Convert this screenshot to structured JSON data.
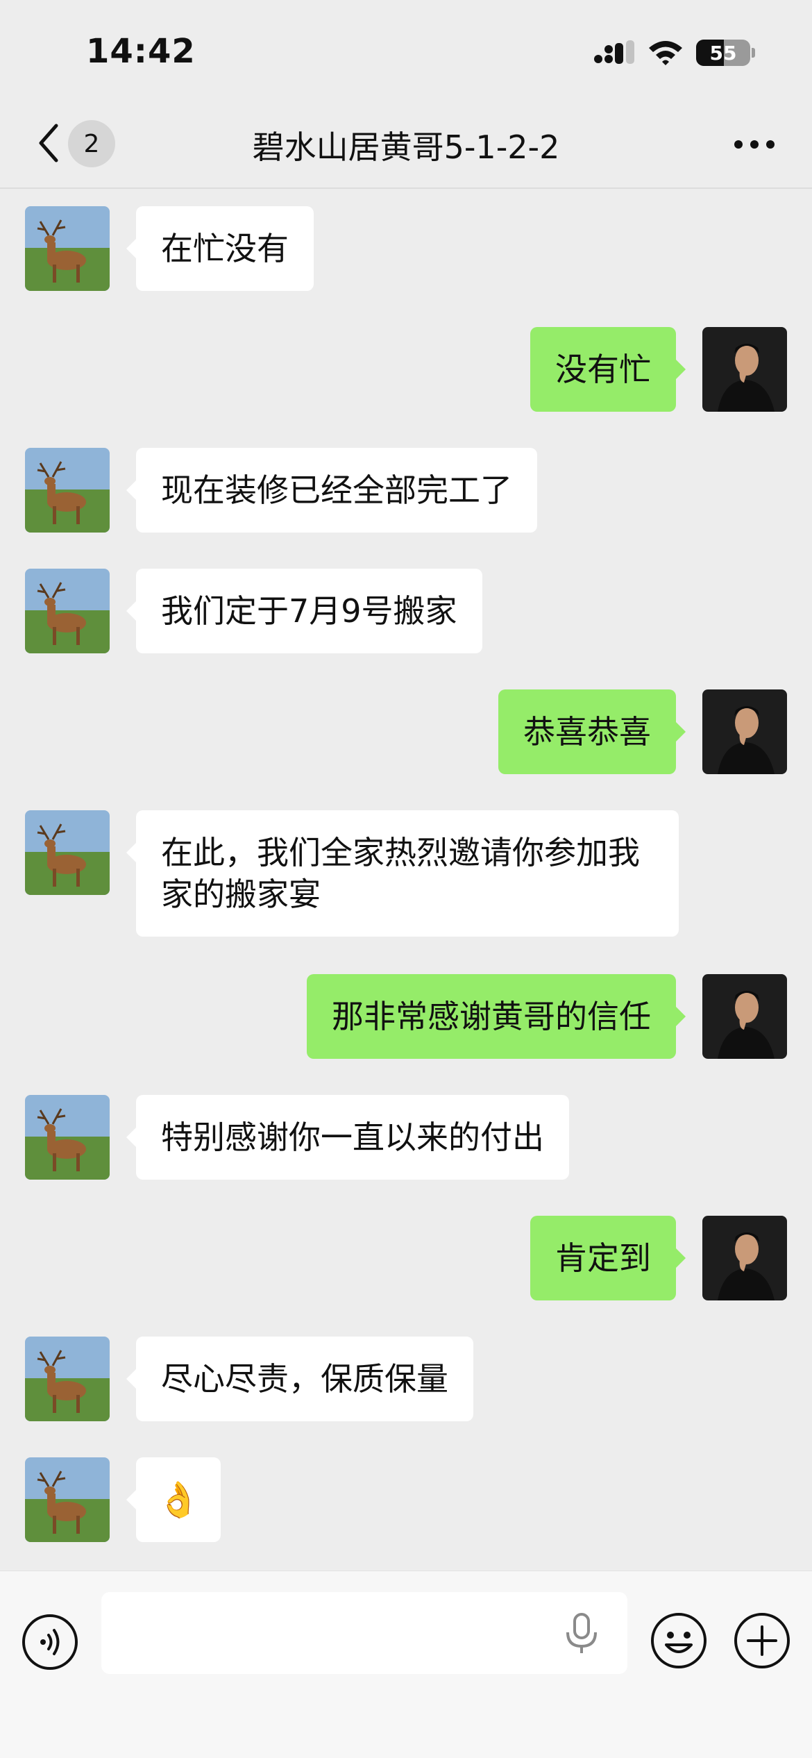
{
  "status_bar": {
    "time": "14:42",
    "battery_level": "55"
  },
  "nav": {
    "back_label": "",
    "unread_count": "2",
    "title": "碧水山居黄哥5-1-2-2"
  },
  "messages": [
    {
      "side": "in",
      "text": "在忙没有"
    },
    {
      "side": "out",
      "text": "没有忙"
    },
    {
      "side": "in",
      "text": "现在装修已经全部完工了"
    },
    {
      "side": "in",
      "text": "我们定于7月9号搬家"
    },
    {
      "side": "out",
      "text": "恭喜恭喜"
    },
    {
      "side": "in",
      "text": "在此，我们全家热烈邀请你参加我家的搬家宴"
    },
    {
      "side": "out",
      "text": "那非常感谢黄哥的信任"
    },
    {
      "side": "in",
      "text": "特别感谢你一直以来的付出"
    },
    {
      "side": "out",
      "text": "肯定到"
    },
    {
      "side": "in",
      "text": "尽心尽责，保质保量"
    },
    {
      "side": "in",
      "text": "👌"
    }
  ],
  "input": {
    "placeholder": ""
  },
  "colors": {
    "incoming_bubble": "#ffffff",
    "outgoing_bubble": "#95ec69",
    "background": "#ededed"
  },
  "icons": [
    "back-chevron-icon",
    "more-dots-icon",
    "voice-icon",
    "microphone-icon",
    "emoji-icon",
    "plus-icon",
    "wifi-icon",
    "cellular-signal-icon",
    "battery-icon"
  ]
}
